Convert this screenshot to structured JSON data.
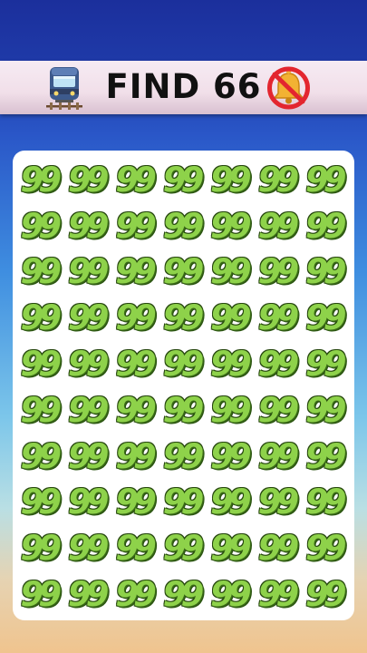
{
  "header": {
    "title": "FIND 66",
    "left_icon": "train-emoji-icon",
    "right_icon": "muted-bell-icon"
  },
  "puzzle": {
    "rows": [
      [
        "99",
        "99",
        "99",
        "99",
        "99",
        "99",
        "99"
      ],
      [
        "99",
        "99",
        "99",
        "99",
        "99",
        "99",
        "99"
      ],
      [
        "99",
        "99",
        "99",
        "99",
        "99",
        "99",
        "99"
      ],
      [
        "99",
        "99",
        "99",
        "99",
        "99",
        "99",
        "99"
      ],
      [
        "99",
        "99",
        "99",
        "99",
        "99",
        "99",
        "99"
      ],
      [
        "99",
        "99",
        "99",
        "99",
        "99",
        "99",
        "99"
      ],
      [
        "99",
        "99",
        "99",
        "99",
        "99",
        "99",
        "99"
      ],
      [
        "99",
        "99",
        "99",
        "99",
        "99",
        "99",
        "99"
      ],
      [
        "99",
        "99",
        "99",
        "99",
        "99",
        "99",
        "99"
      ],
      [
        "99",
        "99",
        "99",
        "99",
        "99",
        "99",
        "99"
      ]
    ]
  },
  "colors": {
    "number_fill": "#8ed24a",
    "number_outline": "#27470f",
    "board": "#ffffff",
    "background_top": "#1b2f9c",
    "background_bottom": "#f0c48e"
  }
}
